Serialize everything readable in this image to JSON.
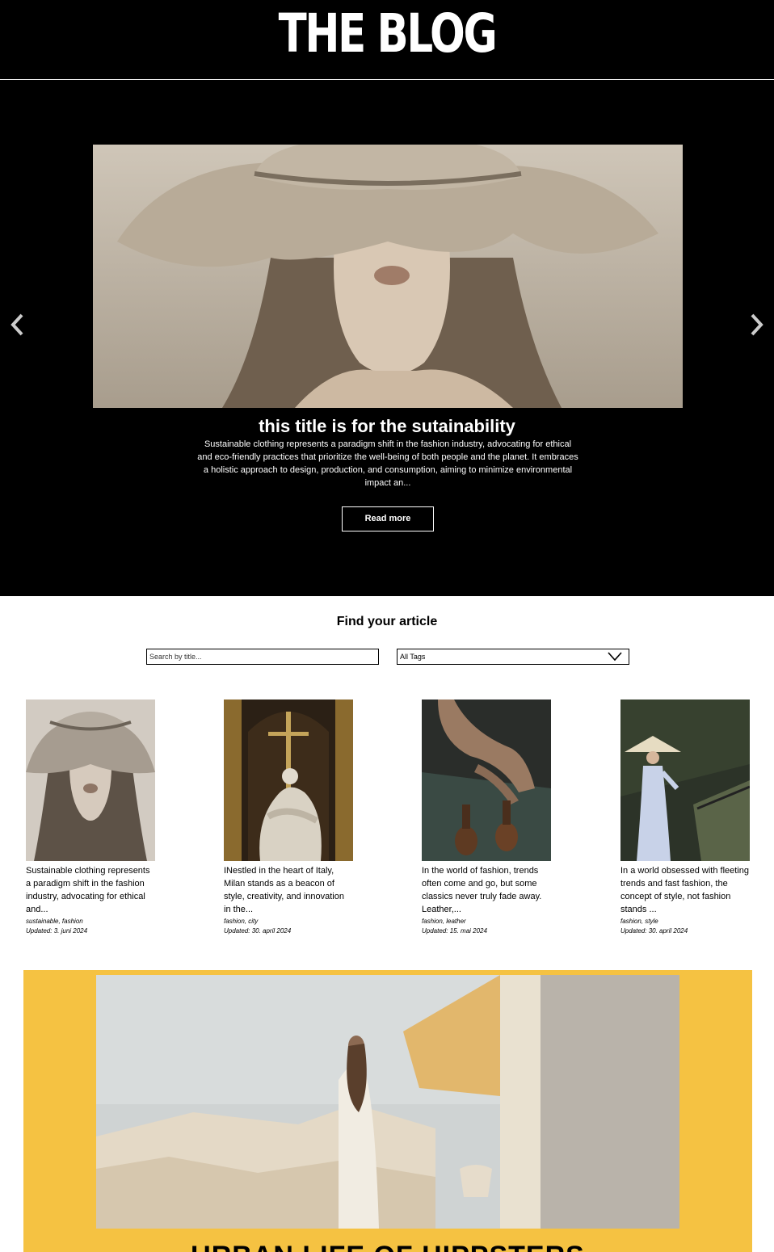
{
  "header": {
    "title": "THE BLOG"
  },
  "hero": {
    "title": "this title is for the sutainability",
    "excerpt": "Sustainable clothing represents a paradigm shift in the fashion industry, advocating for ethical and eco-friendly practices that prioritize the well-being of both people and the planet. It embraces a holistic approach to design, production, and consumption, aiming to minimize environmental impact an...",
    "read_more_label": "Read more"
  },
  "search": {
    "heading": "Find your article",
    "placeholder": "Search by title...",
    "tags_selected": "All Tags"
  },
  "articles": [
    {
      "excerpt": "Sustainable clothing represents a paradigm shift in the fashion industry, advocating for ethical and...",
      "tags": "sustainable, fashion",
      "updated": "Updated: 3. juni 2024"
    },
    {
      "excerpt": "INestled in the heart of Italy, Milan stands as a beacon of style, creativity, and innovation in the...",
      "tags": "fashion, city",
      "updated": "Updated: 30. april 2024"
    },
    {
      "excerpt": "In the world of fashion, trends often come and go, but some classics never truly fade away. Leather,...",
      "tags": "fashion, leather",
      "updated": "Updated: 15. mai 2024"
    },
    {
      "excerpt": "In a world obsessed with fleeting trends and fast fashion, the concept of style, not fashion stands ...",
      "tags": "fashion, style",
      "updated": "Updated: 30. april 2024"
    }
  ],
  "feature": {
    "title": "URBAN LIFE OF HIPPSTERS",
    "background_color": "#f5c242"
  },
  "icons": {
    "prev": "chevron-left-icon",
    "next": "chevron-right-icon",
    "dropdown": "chevron-down-icon"
  }
}
